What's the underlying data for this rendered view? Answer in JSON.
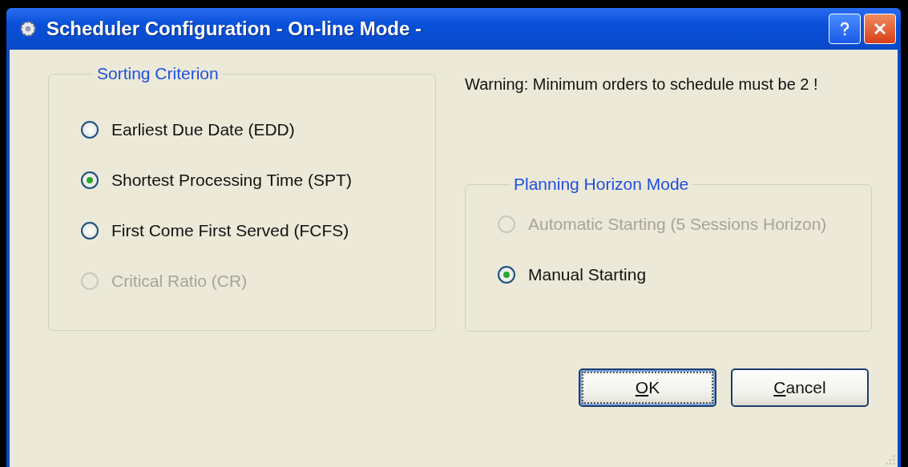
{
  "window": {
    "title": "Scheduler Configuration - On-line Mode -"
  },
  "sorting_criterion": {
    "title": "Sorting Criterion",
    "options": [
      {
        "label": "Earliest Due Date (EDD)",
        "selected": false,
        "disabled": false
      },
      {
        "label": "Shortest Processing Time (SPT)",
        "selected": true,
        "disabled": false
      },
      {
        "label": "First Come First Served (FCFS)",
        "selected": false,
        "disabled": false
      },
      {
        "label": "Critical Ratio (CR)",
        "selected": false,
        "disabled": true
      }
    ]
  },
  "warning": "Warning: Minimum orders to schedule must be 2 !",
  "planning_horizon_mode": {
    "title": "Planning Horizon Mode",
    "options": [
      {
        "label": "Automatic Starting (5 Sessions Horizon)",
        "selected": false,
        "disabled": true
      },
      {
        "label": "Manual Starting",
        "selected": true,
        "disabled": false
      }
    ]
  },
  "buttons": [
    {
      "access_key": "O",
      "label_rest": "K",
      "focused": true
    },
    {
      "access_key": "C",
      "label_rest": "ancel",
      "focused": false
    }
  ]
}
